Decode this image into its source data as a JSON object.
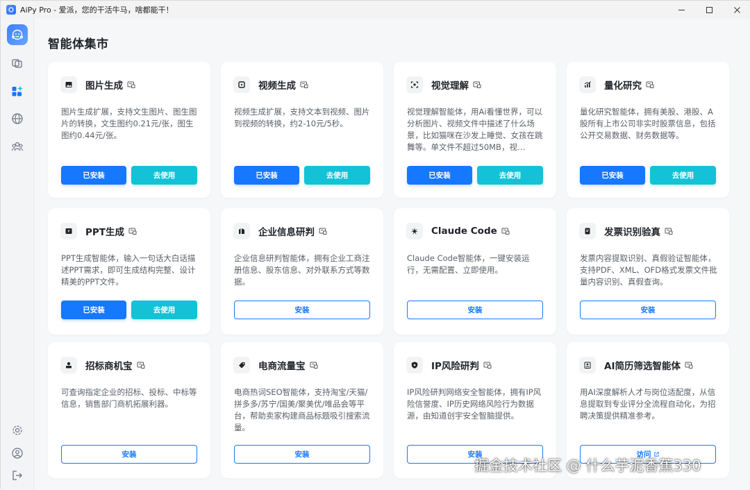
{
  "window": {
    "title": "AiPy Pro - 爱派，您的干活牛马，啥都能干！",
    "minimize_icon": "minimize-icon",
    "maximize_icon": "maximize-icon",
    "close_icon": "close-icon"
  },
  "sidebar": {
    "logo_icon": "robot-logo-icon",
    "top_items": [
      {
        "icon": "cubes-icon"
      },
      {
        "icon": "apps-sparkle-icon",
        "active": true
      },
      {
        "icon": "globe-icon"
      },
      {
        "icon": "people-icon"
      }
    ],
    "bottom_items": [
      {
        "icon": "gear-icon"
      },
      {
        "icon": "user-circle-icon"
      },
      {
        "icon": "logout-icon"
      }
    ]
  },
  "page": {
    "title": "智能体集市"
  },
  "colors": {
    "primary": "#1677ff",
    "cyan": "#13c2d6"
  },
  "cards": [
    {
      "title": "图片生成",
      "icon": "image-icon",
      "desc": "图片生成扩展，支持文生图片、图生图片的转换，文生图约0.21元/张，图生图约0.44元/张。",
      "installed": true,
      "installed_label": "已安装",
      "use_label": "去使用"
    },
    {
      "title": "视频生成",
      "icon": "video-icon",
      "desc": "视频生成扩展，支持文本到视频、图片到视频的转换，约2-10元/5秒。",
      "installed": true,
      "installed_label": "已安装",
      "use_label": "去使用"
    },
    {
      "title": "视觉理解",
      "icon": "eye-scan-icon",
      "desc": "视觉理解智能体，用Ai看懂世界，可以分析图片、视频文件中描述了什么场景，比如猫咪在沙发上睡觉、女孩在跳舞等。单文件不超过50MB，视…",
      "installed": true,
      "installed_label": "已安装",
      "use_label": "去使用"
    },
    {
      "title": "量化研究",
      "icon": "chart-icon",
      "desc": "量化研究智能体，拥有美股、港股、A股所有上市公司非实时股票信息，包括公开交易数据、财务数据等。",
      "installed": true,
      "installed_label": "已安装",
      "use_label": "去使用"
    },
    {
      "title": "PPT生成",
      "icon": "ppt-icon",
      "desc": "PPT生成智能体，输入一句话大白话描述PPT需求，即可生成结构完整、设计精美的PPT文件。",
      "installed": true,
      "installed_label": "已安装",
      "use_label": "去使用"
    },
    {
      "title": "企业信息研判",
      "icon": "building-icon",
      "desc": "企业信息研判智能体，拥有企业工商注册信息、股东信息、对外联系方式等数据。",
      "installed": false,
      "action_label": "安装"
    },
    {
      "title": "Claude Code",
      "icon": "claude-burst-icon",
      "desc": "Claude Code智能体，一键安装运行，无需配置、立即使用。",
      "installed": false,
      "action_label": "安装"
    },
    {
      "title": "发票识别验真",
      "icon": "invoice-icon",
      "desc": "发票内容提取识别、真假验证智能体，支持PDF、XML、OFD格式发票文件批量内容识别、真假查询。",
      "installed": false,
      "action_label": "安装"
    },
    {
      "title": "招标商机宝",
      "icon": "bid-icon",
      "desc": "可查询指定企业的招标、投标、中标等信息，销售部门商机拓展利器。",
      "installed": false,
      "action_label": "安装"
    },
    {
      "title": "电商流量宝",
      "icon": "shop-tag-icon",
      "desc": "电商热词SEO智能体，支持淘宝/天猫/拼多多/苏宁/国美/聚美优/唯品会等平台，帮助卖家构建商品标题吸引搜索流量。",
      "installed": false,
      "action_label": "安装"
    },
    {
      "title": "IP风险研判",
      "icon": "shield-ip-icon",
      "desc": "IP风险研判网络安全智能体，拥有IP风险信誉度、IP历史网络风险行为数据源，由知道创宇安全智脑提供。",
      "installed": false,
      "action_label": "安装"
    },
    {
      "title": "AI简历筛选智能体",
      "icon": "resume-icon",
      "desc": "用AI深度解析人才与岗位适配度，从信息提取到专业评分全流程自动化，为招聘决策提供精准参考。",
      "installed": false,
      "action_label": "访问",
      "external": true
    }
  ],
  "watermark": "掘金技术社区 @ 什么芋泥香蕉330"
}
